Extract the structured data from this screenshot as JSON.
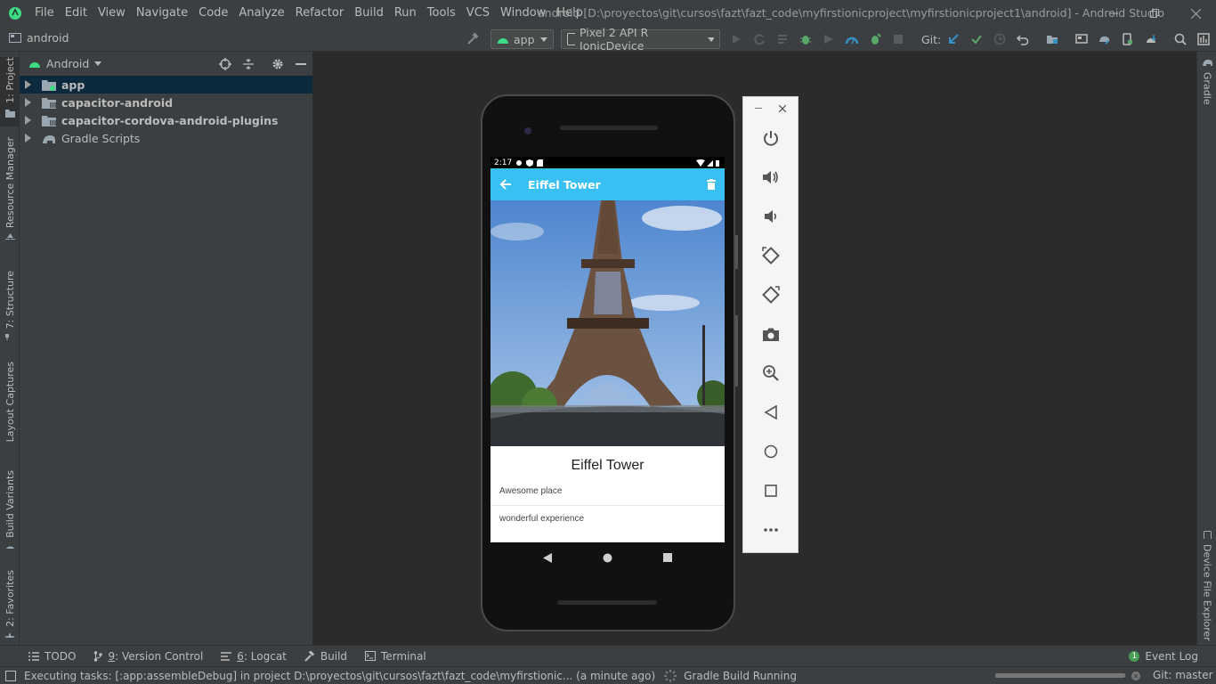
{
  "window": {
    "title": "android [D:\\proyectos\\git\\cursos\\fazt\\fazt_code\\myfirstionicproject\\myfirstionicproject1\\android] - Android Studio"
  },
  "menu": [
    "File",
    "Edit",
    "View",
    "Navigate",
    "Code",
    "Analyze",
    "Refactor",
    "Build",
    "Run",
    "Tools",
    "VCS",
    "Window",
    "Help"
  ],
  "navbar": {
    "breadcrumb": "android",
    "run_config": "app",
    "device": "Pixel 2 API R IonicDevice",
    "git_label": "Git:"
  },
  "left_tabs": [
    "1: Project",
    "Resource Manager",
    "7: Structure",
    "Layout Captures",
    "Build Variants",
    "2: Favorites"
  ],
  "right_tabs": [
    "Gradle",
    "Device File Explorer"
  ],
  "project": {
    "view": "Android",
    "items": [
      "app",
      "capacitor-android",
      "capacitor-cordova-android-plugins",
      "Gradle Scripts"
    ]
  },
  "phone": {
    "time": "2:17",
    "appbar_title": "Eiffel Tower",
    "heading": "Eiffel Tower",
    "comments": [
      "Awesome place",
      "wonderful experience"
    ]
  },
  "bottom_tabs": [
    {
      "mnemonic": "",
      "label": "TODO"
    },
    {
      "mnemonic": "9",
      "label": ": Version Control"
    },
    {
      "mnemonic": "6",
      "label": ": Logcat"
    },
    {
      "mnemonic": "",
      "label": "Build"
    },
    {
      "mnemonic": "",
      "label": "Terminal"
    }
  ],
  "event_log": {
    "count": "1",
    "label": "Event Log"
  },
  "status": {
    "message": "Executing tasks: [:app:assembleDebug] in project D:\\proyectos\\git\\cursos\\fazt\\fazt_code\\myfirstionic... (a minute ago)",
    "progress_label": "Gradle Build Running",
    "git_branch": "Git: master"
  },
  "colors": {
    "accent": "#38c0f3",
    "ide_bg": "#2b2b2b",
    "panel_bg": "#3c3f41",
    "selection": "#0d293e"
  }
}
